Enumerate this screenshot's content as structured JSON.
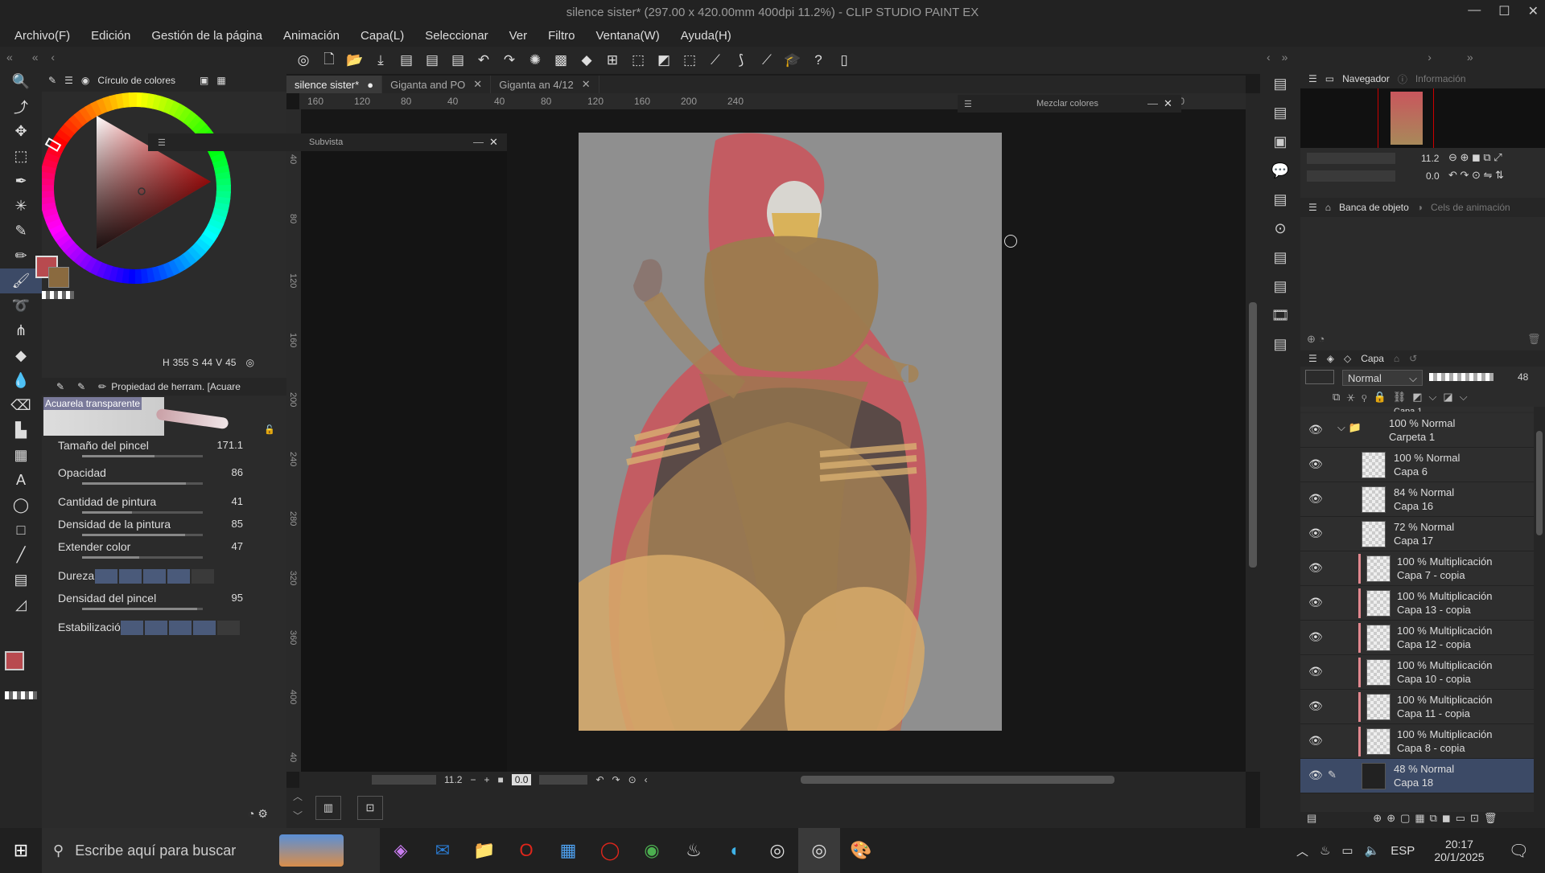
{
  "window": {
    "title": "silence sister* (297.00 x 420.00mm 400dpi 11.2%)  - CLIP STUDIO PAINT EX"
  },
  "menu": [
    "Archivo(F)",
    "Edición",
    "Gestión de la página",
    "Animación",
    "Capa(L)",
    "Seleccionar",
    "Ver",
    "Filtro",
    "Ventana(W)",
    "Ayuda(H)"
  ],
  "tabs": [
    {
      "label": "silence sister*"
    },
    {
      "label": "Giganta and PO"
    },
    {
      "label": "Giganta an 4/12"
    }
  ],
  "color_panel": {
    "title": "Círculo de colores",
    "readout": {
      "h": "355",
      "s": "44",
      "v": "45"
    }
  },
  "subview": {
    "title": "Subvista"
  },
  "mix_colors": {
    "title": "Mezclar colores"
  },
  "tool_property": {
    "header": "Propiedad de herram. [Acuare",
    "brush_name": "Acuarela transparente",
    "props": [
      {
        "label": "Tamaño del pincel",
        "value": "171.1",
        "fill": 0.6
      },
      {
        "label": "Opacidad",
        "value": "86",
        "fill": 0.86
      },
      {
        "label": "Cantidad de pintura",
        "value": "41",
        "fill": 0.41
      },
      {
        "label": "Densidad de la pintura",
        "value": "85",
        "fill": 0.85
      },
      {
        "label": "Extender color",
        "value": "47",
        "fill": 0.47
      },
      {
        "label": "Dureza",
        "value": ""
      },
      {
        "label": "Densidad del pincel",
        "value": "95",
        "fill": 0.95
      },
      {
        "label": "Estabilización",
        "value": ""
      }
    ]
  },
  "ruler_top": [
    "160",
    "120",
    "80",
    "40",
    "40",
    "80",
    "120",
    "160",
    "200",
    "240",
    "440"
  ],
  "ruler_left": [
    "40",
    "80",
    "120",
    "160",
    "200",
    "240",
    "280",
    "320",
    "360",
    "400",
    "40"
  ],
  "status": {
    "zoom": "11.2",
    "rotation": "0.0"
  },
  "navigator": {
    "tab1": "Navegador",
    "tab2": "Información",
    "zoom": "11.2",
    "rotation": "0.0"
  },
  "object_panel": {
    "tab1": "Banca de objeto",
    "tab2": "Cels de animación"
  },
  "layer_panel": {
    "tab": "Capa",
    "blend_mode": "Normal",
    "opacity": "48",
    "top_partial": "Capa 1",
    "layers": [
      {
        "mode": "100 % Normal",
        "name": "Carpeta 1",
        "folder": true
      },
      {
        "mode": "100 % Normal",
        "name": "Capa 6"
      },
      {
        "mode": "84 % Normal",
        "name": "Capa 16"
      },
      {
        "mode": "72 % Normal",
        "name": "Capa 17"
      },
      {
        "mode": "100 % Multiplicación",
        "name": "Capa 7 - copia",
        "clip": true
      },
      {
        "mode": "100 % Multiplicación",
        "name": "Capa 13 - copia",
        "clip": true
      },
      {
        "mode": "100 % Multiplicación",
        "name": "Capa 12 - copia",
        "clip": true
      },
      {
        "mode": "100 % Multiplicación",
        "name": "Capa 10 - copia",
        "clip": true
      },
      {
        "mode": "100 % Multiplicación",
        "name": "Capa 11 - copia",
        "clip": true
      },
      {
        "mode": "100 % Multiplicación",
        "name": "Capa 8 - copia",
        "clip": true
      },
      {
        "mode": "48 % Normal",
        "name": "Capa 18",
        "selected": true
      }
    ]
  },
  "taskbar": {
    "search_placeholder": "Escribe aquí para buscar",
    "lang": "ESP",
    "time": "20:17",
    "date": "20/1/2025"
  },
  "colors": {
    "main": "#b84a4f",
    "sub": "#8a6a3f",
    "canvas_bg": "#8f8f8f",
    "selection": "#3c4a66",
    "clip_bar": "#e0868d"
  }
}
